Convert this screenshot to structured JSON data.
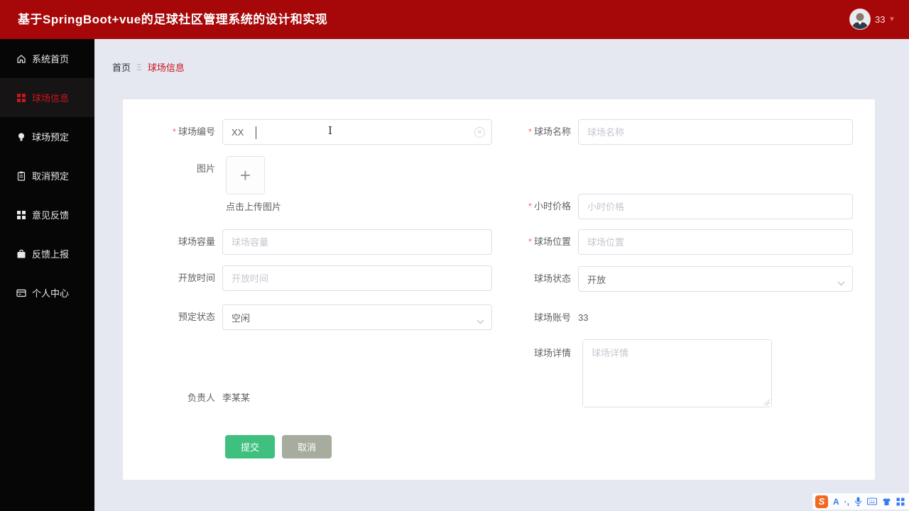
{
  "header": {
    "title": "基于SpringBoot+vue的足球社区管理系统的设计和实现",
    "username": "33",
    "caret": "▼"
  },
  "sidebar": {
    "items": [
      {
        "label": "系统首页",
        "icon": "home-icon",
        "active": false
      },
      {
        "label": "球场信息",
        "icon": "grid-icon",
        "active": true
      },
      {
        "label": "球场预定",
        "icon": "bulb-icon",
        "active": false
      },
      {
        "label": "取消预定",
        "icon": "clipboard-icon",
        "active": false
      },
      {
        "label": "意见反馈",
        "icon": "apps-icon",
        "active": false
      },
      {
        "label": "反馈上报",
        "icon": "briefcase-icon",
        "active": false
      },
      {
        "label": "个人中心",
        "icon": "idcard-icon",
        "active": false
      }
    ]
  },
  "breadcrumb": {
    "home": "首页",
    "separator": "Ξ",
    "current": "球场信息"
  },
  "required_mark": "*",
  "form": {
    "field_no": {
      "label": "球场编号",
      "required": true,
      "value": "XX"
    },
    "image": {
      "label": "图片",
      "plus": "+",
      "upload_hint": "点击上传图片"
    },
    "capacity": {
      "label": "球场容量",
      "placeholder": "球场容量"
    },
    "open_time": {
      "label": "开放时间",
      "placeholder": "开放时间"
    },
    "reserve_status": {
      "label": "预定状态",
      "value": "空闲"
    },
    "manager": {
      "label": "负责人",
      "value": "李某某"
    },
    "name": {
      "label": "球场名称",
      "required": true,
      "placeholder": "球场名称"
    },
    "hour_price": {
      "label": "小时价格",
      "required": true,
      "placeholder": "小时价格"
    },
    "location": {
      "label": "球场位置",
      "required": true,
      "placeholder": "球场位置"
    },
    "field_status": {
      "label": "球场状态",
      "value": "开放"
    },
    "account": {
      "label": "球场账号",
      "value": "33"
    },
    "detail": {
      "label": "球场详情",
      "placeholder": "球场详情"
    }
  },
  "buttons": {
    "submit": "提交",
    "cancel": "取消"
  },
  "ime": {
    "logo": "S",
    "mode": "A",
    "punct": "·,"
  },
  "colors": {
    "header_red": "#a60708",
    "accent_red": "#c8161d",
    "submit_green": "#3fc07f",
    "cancel_gray": "#a6ad9f",
    "background": "#e5e8f1"
  }
}
